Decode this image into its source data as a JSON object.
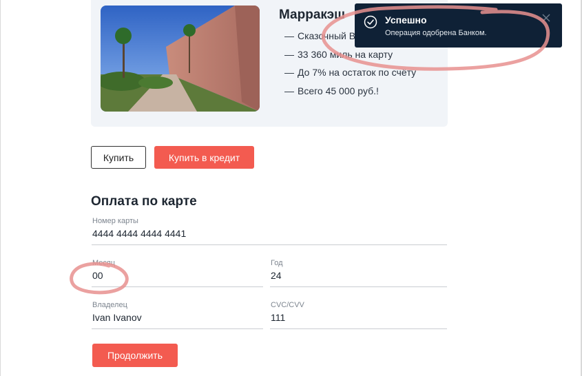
{
  "product": {
    "title": "Марракэш",
    "features": [
      "Сказочный Восток",
      "33 360 миль на карту",
      "До 7% на остаток по счёту",
      "Всего 45 000 руб.!"
    ],
    "dash": "—"
  },
  "actions": {
    "buy_label": "Купить",
    "credit_label": "Купить в кредит"
  },
  "payment": {
    "heading": "Оплата по карте",
    "fields": {
      "card_number": {
        "label": "Номер карты",
        "value": "4444 4444 4444 4441"
      },
      "month": {
        "label": "Месяц",
        "value": "00"
      },
      "year": {
        "label": "Год",
        "value": "24"
      },
      "holder": {
        "label": "Владелец",
        "value": "Ivan Ivanov"
      },
      "cvc": {
        "label": "CVC/CVV",
        "value": "111"
      }
    },
    "continue_label": "Продолжить"
  },
  "toast": {
    "title": "Успешно",
    "message": "Операция одобрена Банком.",
    "icon": "check-circle-icon",
    "close_icon": "close-icon"
  },
  "colors": {
    "accent": "#f35b50",
    "toast_bg": "#0f2136",
    "card_bg": "#f1f4f8",
    "annotation": "#e8908f"
  }
}
